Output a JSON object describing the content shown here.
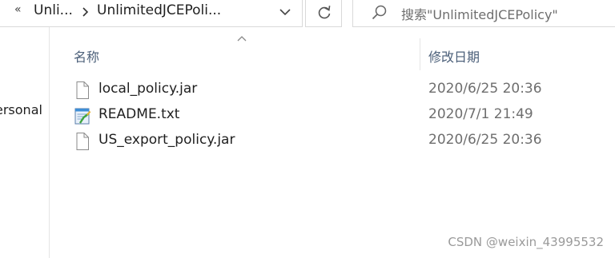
{
  "address_bar": {
    "overflow": "«",
    "crumbs": [
      "Unli...",
      "UnlimitedJCEPoli..."
    ]
  },
  "search": {
    "placeholder": "搜索\"UnlimitedJCEPolicy\""
  },
  "nav_pane": {
    "visible_item": "ersonal"
  },
  "columns": {
    "name": "名称",
    "date_modified": "修改日期",
    "sort": "ascending"
  },
  "files": [
    {
      "name": "local_policy.jar",
      "date": "2020/6/25 20:36",
      "icon": "blank-file-icon"
    },
    {
      "name": "README.txt",
      "date": "2020/7/1 21:49",
      "icon": "notepad-text-file-icon"
    },
    {
      "name": "US_export_policy.jar",
      "date": "2020/6/25 20:36",
      "icon": "blank-file-icon"
    }
  ],
  "watermark": "CSDN @weixin_43995532"
}
